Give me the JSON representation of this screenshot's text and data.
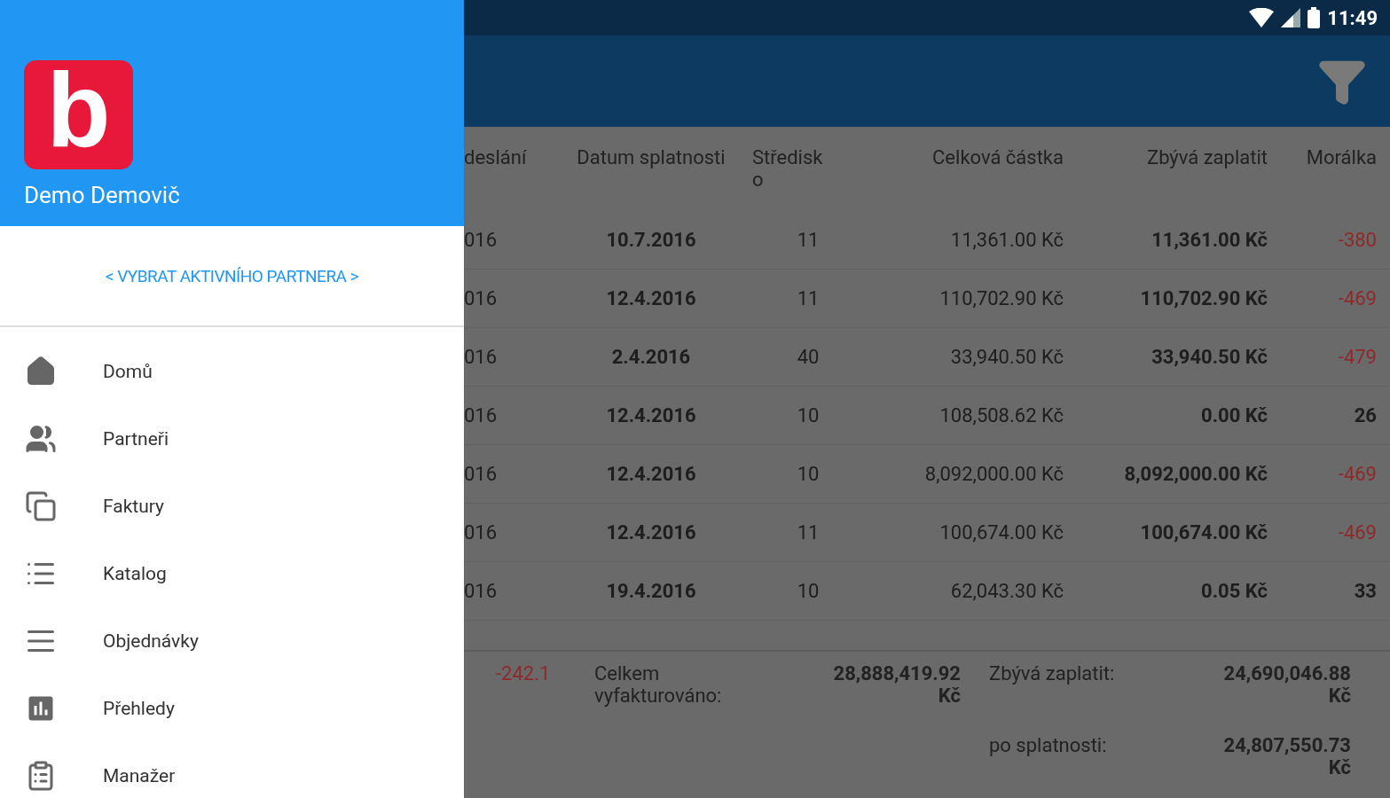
{
  "status_bar": {
    "time": "11:49"
  },
  "drawer": {
    "logo_letter": "b",
    "user_name": "Demo Demovič",
    "partner_link": "< VYBRAT AKTIVNÍHO PARTNERA >",
    "menu": [
      {
        "label": "Domů",
        "kind": "home"
      },
      {
        "label": "Partneři",
        "kind": "people"
      },
      {
        "label": "Faktury",
        "kind": "copies"
      },
      {
        "label": "Katalog",
        "kind": "list"
      },
      {
        "label": "Objednávky",
        "kind": "lines"
      },
      {
        "label": "Přehledy",
        "kind": "chart"
      },
      {
        "label": "Manažer",
        "kind": "clipboard"
      }
    ]
  },
  "table": {
    "columns": [
      "deslání",
      "Datum splatnosti",
      "Středisko",
      "Celková částka",
      "Zbývá zaplatit",
      "Morálka"
    ],
    "rows": [
      {
        "cells": [
          "016",
          "10.7.2016",
          "11",
          "11,361.00 Kč",
          "11,361.00 Kč",
          "-380"
        ],
        "negative": true
      },
      {
        "cells": [
          "016",
          "12.4.2016",
          "11",
          "110,702.90 Kč",
          "110,702.90 Kč",
          "-469"
        ],
        "negative": true
      },
      {
        "cells": [
          "016",
          "2.4.2016",
          "40",
          "33,940.50 Kč",
          "33,940.50 Kč",
          "-479"
        ],
        "negative": true
      },
      {
        "cells": [
          "016",
          "12.4.2016",
          "10",
          "108,508.62 Kč",
          "0.00 Kč",
          "26"
        ],
        "negative": false
      },
      {
        "cells": [
          "016",
          "12.4.2016",
          "10",
          "8,092,000.00 Kč",
          "8,092,000.00 Kč",
          "-469"
        ],
        "negative": true
      },
      {
        "cells": [
          "016",
          "12.4.2016",
          "11",
          "100,674.00 Kč",
          "100,674.00 Kč",
          "-469"
        ],
        "negative": true
      },
      {
        "cells": [
          "016",
          "19.4.2016",
          "10",
          "62,043.30 Kč",
          "0.05 Kč",
          "33"
        ],
        "negative": false
      }
    ]
  },
  "summary": {
    "average": "-242.1",
    "invoiced_label": "Celkem vyfakturováno:",
    "invoiced_value": "28,888,419.92 Kč",
    "remaining_label": "Zbývá zaplatit:",
    "remaining_value": "24,690,046.88 Kč",
    "overdue_label": "po splatnosti:",
    "overdue_value": "24,807,550.73 Kč"
  }
}
